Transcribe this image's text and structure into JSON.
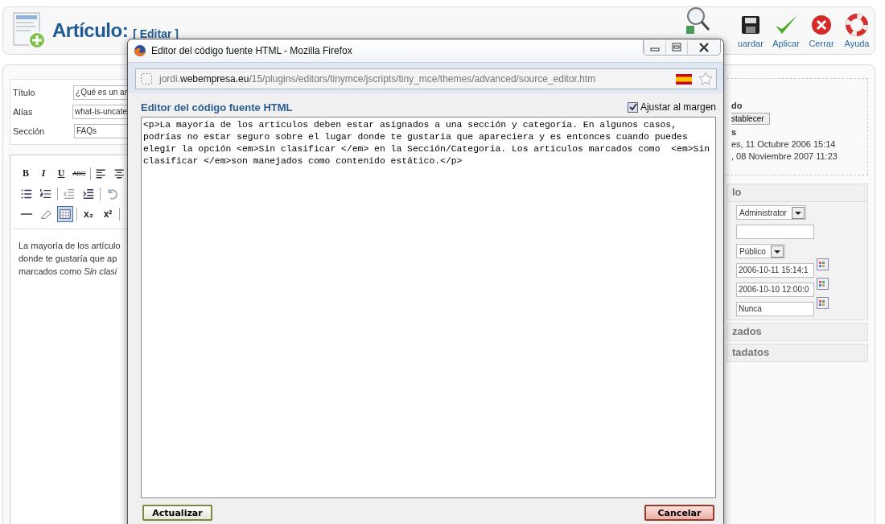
{
  "header": {
    "title": "Artículo:",
    "subtitle": "[ Editar ]",
    "toolbar": [
      {
        "kind": "preview"
      },
      {
        "kind": "save",
        "label": "uardar"
      },
      {
        "kind": "apply",
        "label": "Aplicar"
      },
      {
        "kind": "close",
        "label": "Cerrar"
      },
      {
        "kind": "help",
        "label": "Ayuda"
      }
    ]
  },
  "form": {
    "fields": [
      {
        "label": "Título",
        "value": "¿Qué es un ar"
      },
      {
        "label": "Alías",
        "value": "what-is-uncate"
      },
      {
        "label": "Sección",
        "value": "FAQs"
      }
    ]
  },
  "editor": {
    "toolbar": [
      [
        {
          "kind": "bold",
          "label": "B"
        },
        {
          "kind": "italic",
          "label": "I"
        },
        {
          "kind": "underline",
          "label": "U"
        },
        {
          "kind": "strike",
          "label": "ABC"
        },
        {
          "kind": "separator"
        },
        {
          "kind": "align-left"
        },
        {
          "kind": "align-center"
        }
      ],
      [
        {
          "kind": "bullets"
        },
        {
          "kind": "numbers"
        },
        {
          "kind": "separator"
        },
        {
          "kind": "outdent"
        },
        {
          "kind": "indent"
        },
        {
          "kind": "separator"
        },
        {
          "kind": "undo"
        }
      ],
      [
        {
          "kind": "rule"
        },
        {
          "kind": "eraser"
        },
        {
          "kind": "table",
          "selected": true
        },
        {
          "kind": "separator"
        },
        {
          "kind": "subscript",
          "label": "x₂"
        },
        {
          "kind": "superscript",
          "label": "x²"
        },
        {
          "kind": "separator"
        }
      ]
    ],
    "content_lines": [
      "La mayoría de los artículo",
      "donde te gustaría que ap",
      "marcados como *Sin clasi*"
    ]
  },
  "details": {
    "lines": [
      {
        "kind": "bold",
        "text": "do"
      },
      {
        "kind": "button",
        "text": "stablecer"
      },
      {
        "kind": "bold",
        "text": "s"
      },
      {
        "kind": "text",
        "text": "es, 11 Octubre 2006 15:14"
      },
      {
        "kind": "text",
        "text": ", 08 Noviembre 2007 11:23"
      }
    ]
  },
  "parameters": {
    "title": "lo",
    "fields": [
      {
        "kind": "select",
        "value": "Administrator"
      },
      {
        "kind": "input"
      },
      {
        "kind": "select",
        "value": "Público"
      },
      {
        "kind": "date",
        "value": "2006-10-11 15:14:1"
      },
      {
        "kind": "date",
        "value": "2006-10-10 12:00:0"
      },
      {
        "kind": "date",
        "value": "Nunca"
      }
    ]
  },
  "collapsed_panels": [
    {
      "title": "zados"
    },
    {
      "title": "tadatos"
    }
  ],
  "popup": {
    "title": "Editor del código fuente HTML - Mozilla Firefox",
    "url": {
      "host_prefix": "jordi.",
      "host": "webempresa.eu",
      "path": "/15/plugins/editors/tinymce/jscripts/tiny_mce/themes/advanced/source_editor.htm"
    },
    "heading": "Editor del código fuente HTML",
    "wrap": {
      "label": "Ajustar al margen",
      "checked": true
    },
    "source": "<p>La mayoría de los artículos deben estar asignados a una sección y categoría. En algunos casos, podrías no estar seguro sobre el lugar donde te gustaría que apareciera y es entonces cuando puedes elegir la opción <em>Sin clasificar </em> en la Sección/Categoría. Los artículos marcados como  <em>Sin clasificar </em>son manejados como contenido estático.</p>",
    "buttons": [
      {
        "kind": "primary",
        "label": "Actualizar"
      },
      {
        "kind": "cancel",
        "label": "Cancelar"
      }
    ]
  }
}
